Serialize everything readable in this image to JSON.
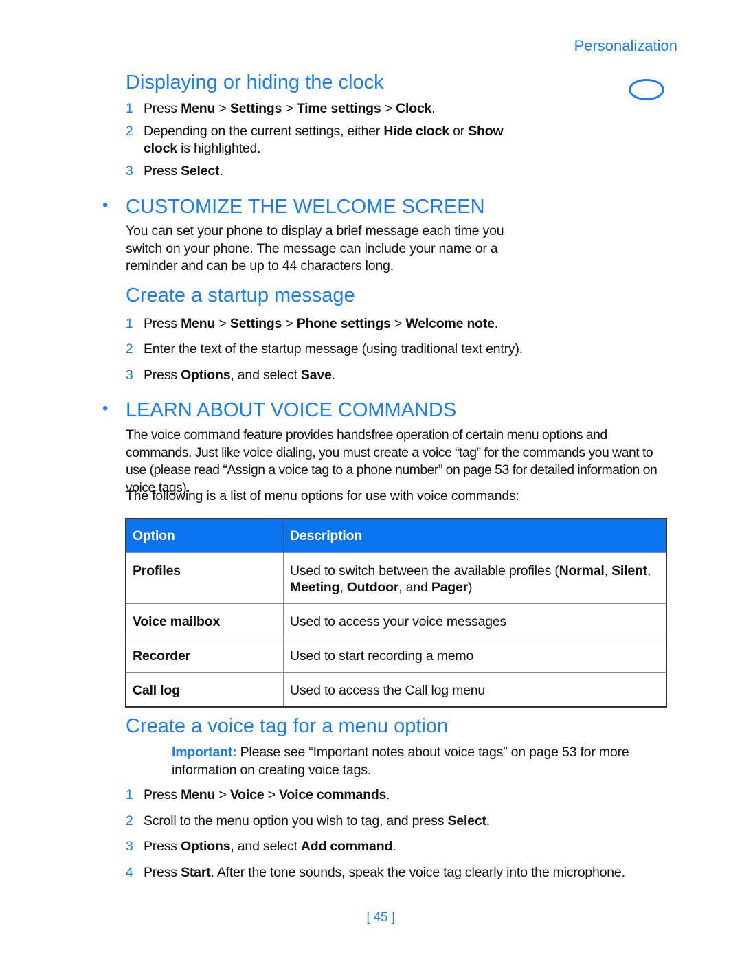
{
  "header": {
    "section": "Personalization",
    "icon": "oval-icon"
  },
  "clock": {
    "title": "Displaying or hiding the clock",
    "steps": [
      [
        {
          "t": "Press "
        },
        {
          "t": "Menu",
          "b": 1
        },
        {
          "t": " > "
        },
        {
          "t": "Settings",
          "b": 1
        },
        {
          "t": " > "
        },
        {
          "t": "Time settings",
          "b": 1
        },
        {
          "t": " > "
        },
        {
          "t": "Clock",
          "b": 1
        },
        {
          "t": "."
        }
      ],
      [
        {
          "t": "Depending on the current settings, either "
        },
        {
          "t": "Hide clock",
          "b": 1
        },
        {
          "t": " or "
        },
        {
          "t": "Show clock",
          "b": 1
        },
        {
          "t": " is highlighted."
        }
      ],
      [
        {
          "t": "Press "
        },
        {
          "t": "Select",
          "b": 1
        },
        {
          "t": "."
        }
      ]
    ]
  },
  "welcome": {
    "title": "CUSTOMIZE THE WELCOME SCREEN",
    "body": "You can set your phone to display a brief message each time you switch on your phone. The message can include your name or a reminder and can be up to 44 characters long."
  },
  "startup": {
    "title": "Create a startup message",
    "steps": [
      [
        {
          "t": "Press "
        },
        {
          "t": "Menu",
          "b": 1
        },
        {
          "t": " > "
        },
        {
          "t": "Settings",
          "b": 1
        },
        {
          "t": " > "
        },
        {
          "t": "Phone settings",
          "b": 1
        },
        {
          "t": " > "
        },
        {
          "t": "Welcome note",
          "b": 1
        },
        {
          "t": "."
        }
      ],
      [
        {
          "t": "Enter the text of the startup message (using traditional text entry)."
        }
      ],
      [
        {
          "t": "Press "
        },
        {
          "t": "Options",
          "b": 1
        },
        {
          "t": ", and select "
        },
        {
          "t": "Save",
          "b": 1
        },
        {
          "t": "."
        }
      ]
    ]
  },
  "voice": {
    "title": "LEARN ABOUT VOICE COMMANDS",
    "body": "The voice command feature provides handsfree operation of certain menu options and commands. Just like voice dialing, you must create a voice “tag” for the commands you want to use (please read “Assign a voice tag to a phone number” on page 53 for detailed information on voice tags).",
    "list_intro": "The following is a list of menu options for use with voice commands:"
  },
  "table": {
    "headers": [
      "Option",
      "Description"
    ],
    "rows": [
      {
        "option": "Profiles",
        "desc": [
          {
            "t": "Used to switch between the available profiles ("
          },
          {
            "t": "Normal",
            "b": 1
          },
          {
            "t": ", "
          },
          {
            "t": "Silent",
            "b": 1
          },
          {
            "t": ", "
          },
          {
            "t": "Meeting",
            "b": 1
          },
          {
            "t": ", "
          },
          {
            "t": "Outdoor",
            "b": 1
          },
          {
            "t": ", and "
          },
          {
            "t": "Pager",
            "b": 1
          },
          {
            "t": ")"
          }
        ]
      },
      {
        "option": "Voice mailbox",
        "desc": [
          {
            "t": "Used to access your voice messages"
          }
        ]
      },
      {
        "option": "Recorder",
        "desc": [
          {
            "t": "Used to start recording a memo"
          }
        ]
      },
      {
        "option": "Call log",
        "desc": [
          {
            "t": "Used to access the Call log menu"
          }
        ]
      }
    ]
  },
  "voicetag": {
    "title": "Create a voice tag for a menu option",
    "important_label": "Important:",
    "important_text": " Please see “Important notes about voice tags” on page 53 for more information on creating voice tags.",
    "steps": [
      [
        {
          "t": "Press "
        },
        {
          "t": "Menu",
          "b": 1
        },
        {
          "t": " > "
        },
        {
          "t": "Voice",
          "b": 1
        },
        {
          "t": " > "
        },
        {
          "t": "Voice commands",
          "b": 1
        },
        {
          "t": "."
        }
      ],
      [
        {
          "t": "Scroll to the menu option you wish to tag, and press "
        },
        {
          "t": "Select",
          "b": 1
        },
        {
          "t": "."
        }
      ],
      [
        {
          "t": "Press "
        },
        {
          "t": "Options",
          "b": 1
        },
        {
          "t": ", and select "
        },
        {
          "t": "Add command",
          "b": 1
        },
        {
          "t": "."
        }
      ],
      [
        {
          "t": "Press "
        },
        {
          "t": "Start",
          "b": 1
        },
        {
          "t": ". After the tone sounds, speak the voice tag clearly into the microphone."
        }
      ]
    ]
  },
  "footer": {
    "page": "[ 45 ]"
  },
  "colors": {
    "accent": "#1a7ef0",
    "table_header": "#0a74f0"
  }
}
